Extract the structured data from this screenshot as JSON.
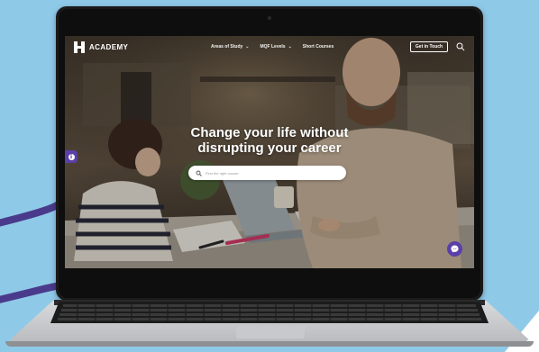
{
  "site": {
    "logo_text": "ACADEMY",
    "nav": {
      "items": [
        {
          "label": "Areas of Study",
          "dropdown": true
        },
        {
          "label": "MQF Levels",
          "dropdown": true
        },
        {
          "label": "Short Courses",
          "dropdown": false
        }
      ],
      "cta_label": "Get in Touch",
      "search_icon": "search-icon"
    },
    "hero": {
      "headline_line1": "Change your life without",
      "headline_line2": "disrupting your career"
    },
    "search": {
      "placeholder": "Find the right course",
      "value": ""
    },
    "info_button_glyph": "i",
    "chat_button_icon": "messenger-icon"
  },
  "colors": {
    "background": "#8fc9e8",
    "accent_purple": "#5b3fa8",
    "laptop_bezel": "#1a1a1a",
    "laptop_base": "#d9dadc"
  }
}
